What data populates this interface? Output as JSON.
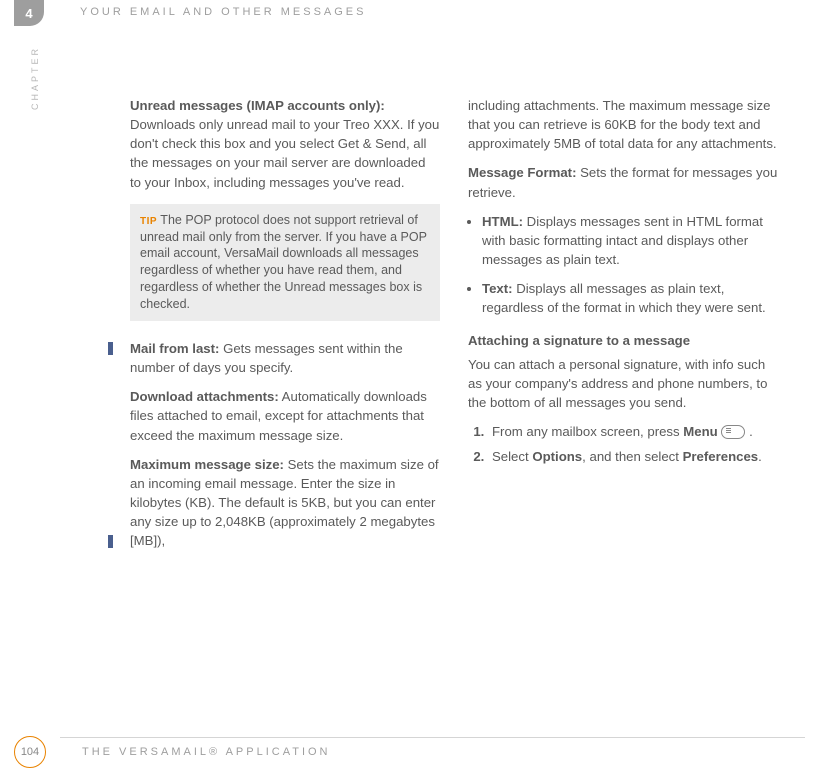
{
  "header": {
    "chapter_number": "4",
    "title": "YOUR EMAIL AND OTHER MESSAGES",
    "side_label": "CHAPTER"
  },
  "left_column": {
    "p1_bold": "Unread messages (IMAP accounts only):",
    "p1_text": " Downloads only unread mail to your Treo XXX. If you don't check this box and you select Get & Send, all the messages on your mail server are downloaded to your Inbox, including messages you've read.",
    "tip_label": "TIP",
    "tip_text": " The POP protocol does not support retrieval of unread mail only from the server. If you have a POP email account, VersaMail downloads all messages regardless of whether you have read them, and regardless of whether the Unread messages box is checked.",
    "p2_bold": "Mail from last:",
    "p2_text": " Gets messages sent within the number of days you specify.",
    "p3_bold": "Download attachments:",
    "p3_text": " Automatically downloads files attached to email, except for attachments that exceed the maximum message size.",
    "p4_bold": "Maximum message size:",
    "p4_text": " Sets the maximum size of an incoming email message. Enter the size in kilobytes (KB). The default is 5KB, but you can enter any size up to 2,048KB (approximately 2 megabytes [MB]),"
  },
  "right_column": {
    "p1_text": "including attachments. The maximum message size that you can retrieve is 60KB for the body text and approximately 5MB of total data for any attachments.",
    "p2_bold": "Message Format:",
    "p2_text": " Sets the format for messages you retrieve.",
    "bullet1_bold": "HTML:",
    "bullet1_text": " Displays messages sent in HTML format with basic formatting intact and displays other messages as plain text.",
    "bullet2_bold": "Text:",
    "bullet2_text": " Displays all messages as plain text, regardless of the format in which they were sent.",
    "heading": "Attaching a signature to a message",
    "heading_text": "You can attach a personal signature, with info such as your company's address and phone numbers, to the bottom of all messages you send.",
    "step1_a": "From any mailbox screen, press ",
    "step1_b": "Menu",
    "step1_c": " .",
    "step2_a": "Select ",
    "step2_b": "Options",
    "step2_c": ", and then select ",
    "step2_d": "Preferences",
    "step2_e": "."
  },
  "footer": {
    "page": "104",
    "title": "THE VERSAMAIL® APPLICATION"
  }
}
